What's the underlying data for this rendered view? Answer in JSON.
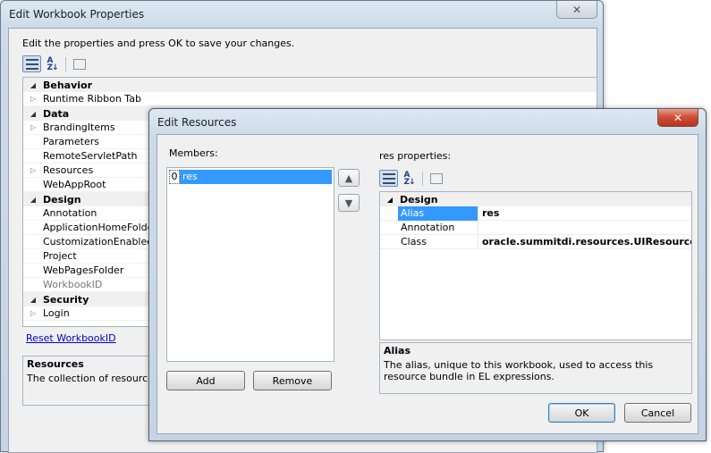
{
  "main_dialog": {
    "title": "Edit Workbook Properties",
    "instruction": "Edit the properties and press OK to save your changes.",
    "toolbar": {
      "categorized_icon": "categorized-icon",
      "alphabetical_icon": "sort-az-icon",
      "property_pages_icon": "property-pages-icon"
    },
    "categories": [
      {
        "name": "Behavior",
        "items": [
          {
            "label": "Runtime Ribbon Tab",
            "expandable": true
          }
        ]
      },
      {
        "name": "Data",
        "items": [
          {
            "label": "BrandingItems",
            "expandable": true
          },
          {
            "label": "Parameters",
            "expandable": false
          },
          {
            "label": "RemoteServletPath",
            "expandable": false
          },
          {
            "label": "Resources",
            "expandable": true
          },
          {
            "label": "WebAppRoot",
            "expandable": false
          }
        ]
      },
      {
        "name": "Design",
        "items": [
          {
            "label": "Annotation",
            "expandable": false
          },
          {
            "label": "ApplicationHomeFolder",
            "expandable": false
          },
          {
            "label": "CustomizationEnabled",
            "expandable": false
          },
          {
            "label": "Project",
            "expandable": false
          },
          {
            "label": "WebPagesFolder",
            "expandable": false
          },
          {
            "label": "WorkbookID",
            "expandable": false
          }
        ]
      },
      {
        "name": "Security",
        "items": [
          {
            "label": "Login",
            "expandable": true
          }
        ]
      }
    ],
    "reset_link": "Reset WorkbookID",
    "description": {
      "title": "Resources",
      "text": "The collection of resource b"
    }
  },
  "resources_dialog": {
    "title": "Edit Resources",
    "close_glyph": "✕",
    "members_label": "Members:",
    "members": [
      {
        "index": "0",
        "name": "res"
      }
    ],
    "add_button": "Add",
    "remove_button": "Remove",
    "properties_label": "res properties:",
    "category": "Design",
    "properties": [
      {
        "name": "Alias",
        "value": "res"
      },
      {
        "name": "Annotation",
        "value": ""
      },
      {
        "name": "Class",
        "value": "oracle.summitdi.resources.UIResources"
      }
    ],
    "description": {
      "title": "Alias",
      "text": "The alias, unique to this workbook, used to access this resource bundle in EL expressions."
    },
    "ok_button": "OK",
    "cancel_button": "Cancel"
  },
  "colors": {
    "selection": "#3399ff",
    "close_red": "#c8402a",
    "link": "#0000cc"
  }
}
